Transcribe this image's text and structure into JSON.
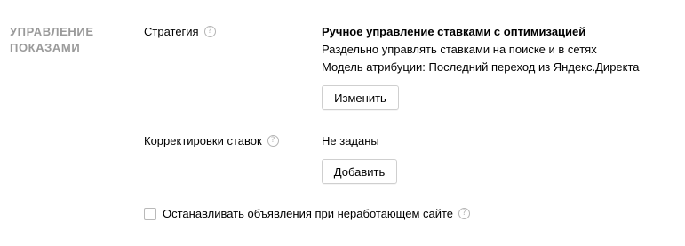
{
  "section": {
    "title_line1": "УПРАВЛЕНИЕ",
    "title_line2": "ПОКАЗАМИ"
  },
  "strategy": {
    "label": "Стратегия",
    "name": "Ручное управление ставками с оптимизацией",
    "description": "Раздельно управлять ставками на поиске и в сетях",
    "attribution": "Модель атрибуции: Последний переход из Яндекс.Директа",
    "button_label": "Изменить"
  },
  "corrections": {
    "label": "Корректировки ставок",
    "value": "Не заданы",
    "button_label": "Добавить"
  },
  "stop_ads": {
    "label": "Останавливать объявления при неработающем сайте",
    "checked": false
  },
  "help_icon_glyph": "?"
}
